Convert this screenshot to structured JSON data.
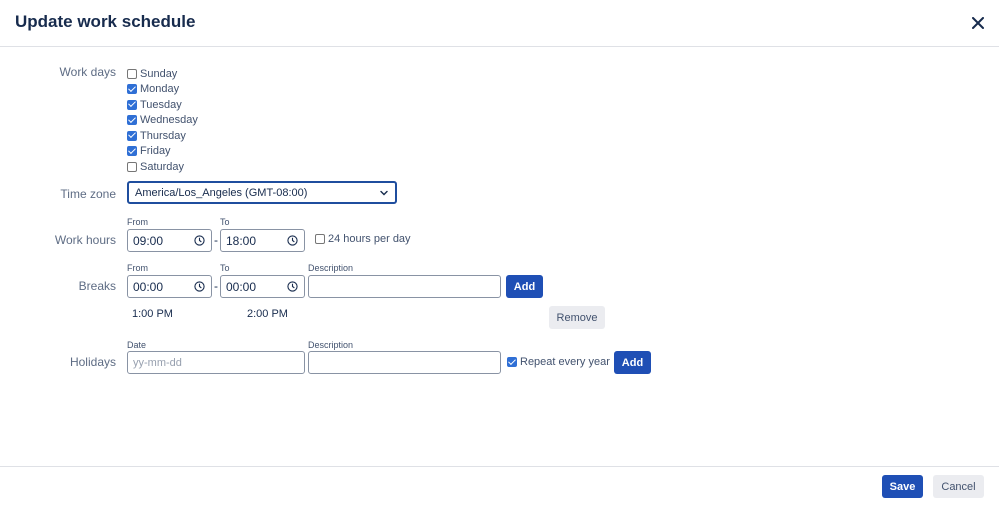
{
  "dialog": {
    "title": "Update work schedule",
    "close_icon": "close-icon"
  },
  "work_days": {
    "label": "Work days",
    "days": [
      {
        "label": "Sunday",
        "checked": false
      },
      {
        "label": "Monday",
        "checked": true
      },
      {
        "label": "Tuesday",
        "checked": true
      },
      {
        "label": "Wednesday",
        "checked": true
      },
      {
        "label": "Thursday",
        "checked": true
      },
      {
        "label": "Friday",
        "checked": true
      },
      {
        "label": "Saturday",
        "checked": false
      }
    ]
  },
  "time_zone": {
    "label": "Time zone",
    "value": "America/Los_Angeles (GMT-08:00)"
  },
  "work_hours": {
    "label": "Work hours",
    "from_label": "From",
    "to_label": "To",
    "from": "09:00",
    "to": "18:00",
    "separator": "-",
    "all_day_label": "24 hours per day",
    "all_day_checked": false
  },
  "breaks": {
    "label": "Breaks",
    "from_label": "From",
    "to_label": "To",
    "description_label": "Description",
    "from": "00:00",
    "to": "00:00",
    "separator": "-",
    "description": "",
    "add_label": "Add",
    "items": [
      {
        "from": "1:00 PM",
        "to": "2:00 PM",
        "remove_label": "Remove"
      }
    ]
  },
  "holidays": {
    "label": "Holidays",
    "date_label": "Date",
    "description_label": "Description",
    "date_placeholder": "yy-mm-dd",
    "description": "",
    "repeat_label": "Repeat every year",
    "repeat_checked": true,
    "add_label": "Add"
  },
  "footer": {
    "save_label": "Save",
    "cancel_label": "Cancel"
  },
  "colors": {
    "primary": "#1f4fb5",
    "checkbox": "#2f6fd5",
    "text": "#172b4d",
    "muted": "#5e6c84"
  }
}
